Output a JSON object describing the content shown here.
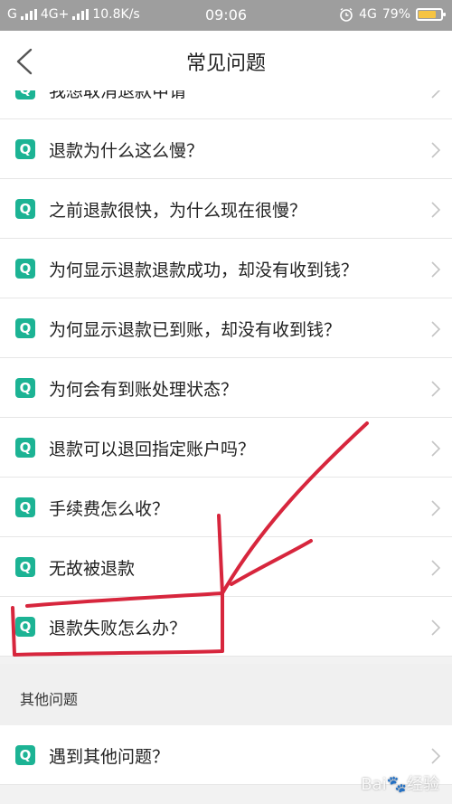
{
  "status_bar": {
    "carrier1": "G",
    "network": "4G+",
    "speed": "10.8K/s",
    "time": "09:06",
    "net2": "4G",
    "battery_percent": "79%",
    "battery_level": 0.79
  },
  "header": {
    "title": "常见问题"
  },
  "faq": {
    "items": [
      {
        "text": "我想取消退款申请"
      },
      {
        "text": "退款为什么这么慢？"
      },
      {
        "text": "之前退款很快，为什么现在很慢？"
      },
      {
        "text": "为何显示退款退款成功，却没有收到钱？"
      },
      {
        "text": "为何显示退款已到账，却没有收到钱？"
      },
      {
        "text": "为何会有到账处理状态？"
      },
      {
        "text": "退款可以退回指定账户吗？"
      },
      {
        "text": "手续费怎么收？"
      },
      {
        "text": "无故被退款"
      },
      {
        "text": "退款失败怎么办？"
      }
    ]
  },
  "section": {
    "title": "其他问题"
  },
  "other": {
    "items": [
      {
        "text": "遇到其他问题？"
      }
    ]
  },
  "badge_letter": "Q",
  "colors": {
    "accent": "#1cb394",
    "annotation": "#d7263d"
  }
}
